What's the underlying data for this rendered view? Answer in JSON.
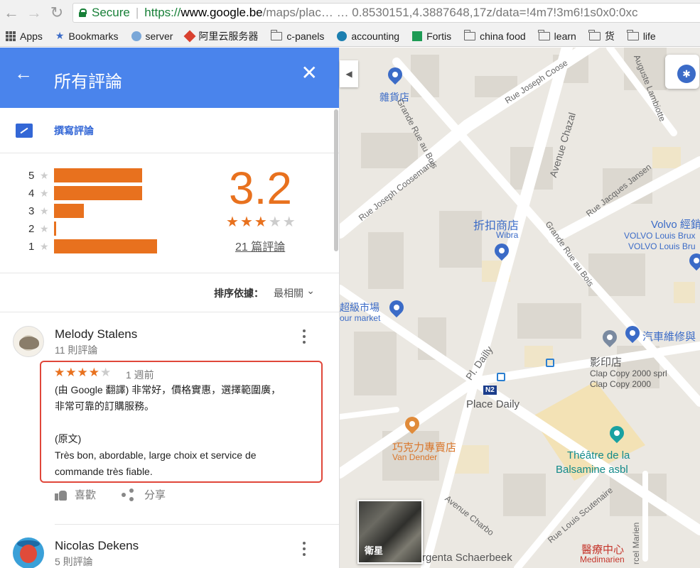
{
  "browser": {
    "secure_label": "Secure",
    "url_https": "https://",
    "url_host": "www.google.be",
    "url_rest": "/maps/plac… … 0.8530151,4.3887648,17z/data=!4m7!3m6!1s0x0:0xc"
  },
  "bookmarks": [
    {
      "label": "Apps"
    },
    {
      "label": "Bookmarks"
    },
    {
      "label": "server"
    },
    {
      "label": "阿里云服务器"
    },
    {
      "label": "c-panels"
    },
    {
      "label": "accounting"
    },
    {
      "label": "Fortis"
    },
    {
      "label": "china food"
    },
    {
      "label": "learn"
    },
    {
      "label": "货"
    },
    {
      "label": "life"
    }
  ],
  "panel": {
    "title": "所有評論",
    "write_review": "撰寫評論",
    "rating": "3.2",
    "rating_value": 3.2,
    "review_count": "21 篇評論",
    "distribution": [
      {
        "star": "5",
        "fraction": 0.47
      },
      {
        "star": "4",
        "fraction": 0.47
      },
      {
        "star": "3",
        "fraction": 0.16
      },
      {
        "star": "2",
        "fraction": 0.01
      },
      {
        "star": "1",
        "fraction": 0.55
      }
    ],
    "sort_label": "排序依據：",
    "sort_value": "最相關"
  },
  "reviews": [
    {
      "name": "Melody Stalens",
      "meta": "11 則評論",
      "stars": 4,
      "date": "1 週前",
      "translated_line1": "(由 Google 翻譯) 非常好，價格實惠，選擇範圍廣，",
      "translated_line2": "非常可靠的訂購服務。",
      "original_label": "(原文)",
      "original_line1": "Très bon, abordable, large choix et service de",
      "original_line2": "commande très fiable.",
      "like_label": "喜歡",
      "share_label": "分享"
    },
    {
      "name": "Nicolas Dekens",
      "meta": "5 則評論"
    }
  ],
  "map": {
    "labels": {
      "grocery": "雜貨店",
      "discount": "折扣商店",
      "discount_en": "Wibra",
      "supermarket": "超級市場",
      "supermarket_en": "our market",
      "volvo": "Volvo 經銷",
      "volvo_en1": "VOLVO Louis Brux",
      "volvo_en2": "VOLVO Louis Bru",
      "car_repair": "汽車維修與",
      "copy": "影印店",
      "copy_en1": "Clap Copy 2000 sprl",
      "copy_en2": "Clap Copy 2000",
      "place_daily": "Place Daily",
      "chocolate": "巧克力專賣店",
      "chocolate_en": "Van Dender",
      "theatre1": "Théâtre de la",
      "theatre2": "Balsamine asbl",
      "medical": "醫療中心",
      "medical_en": "Medimarien",
      "schaerbeek": "rgenta Schaerbeek",
      "satellite": "衛星",
      "n2": "N2"
    },
    "roads": {
      "grande_rue_au_bois": "Grande Rue au Bois",
      "rue_joseph_coosemans": "Rue Joseph Coosemans",
      "rue_joseph_coose": "Rue Joseph Coose",
      "avenue_chazal": "Avenue Chazal",
      "auguste_lambiotte": "Auguste Lambiotte",
      "rue_jacques_jansen": "Rue Jacques Jansen",
      "grande_rue_au_bois_2": "Grande Rue au Bois",
      "pl_dailly": "Pl. Dailly",
      "avenue_charbo": "Avenue Charbo",
      "rue_louis_scutenaire": "Rue Louis Scutenaire",
      "rcel_marien": "rcel Marien"
    }
  }
}
